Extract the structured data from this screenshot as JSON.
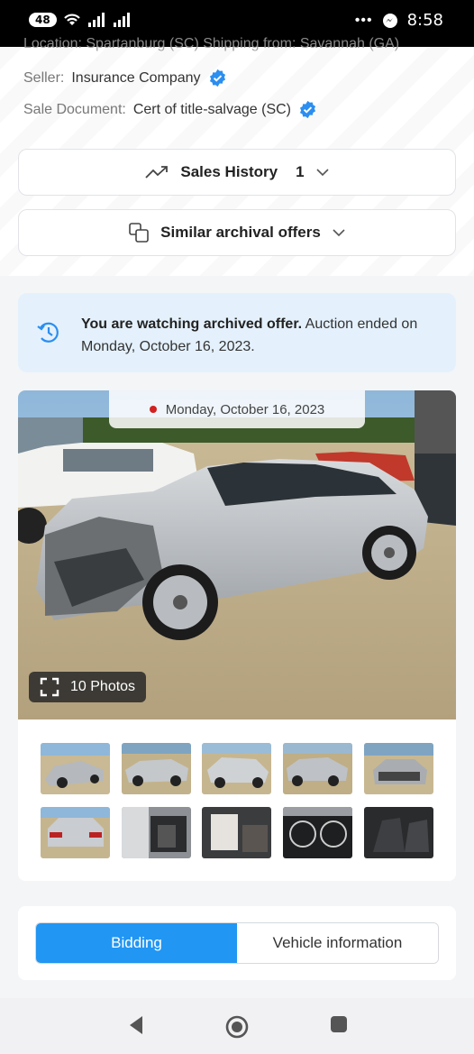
{
  "status_bar": {
    "badge": "48",
    "time": "8:58"
  },
  "details": {
    "cut_line": "Location: Spartanburg (SC)   Shipping from: Savannah (GA)",
    "seller_label": "Seller:",
    "seller_value": "Insurance Company",
    "sale_doc_label": "Sale Document:",
    "sale_doc_value": "Cert of title-salvage (SC)"
  },
  "sales_history": {
    "label": "Sales History",
    "count": "1"
  },
  "similar_offers": {
    "label": "Similar archival offers"
  },
  "banner": {
    "bold": "You are watching archived offer.",
    "text": " Auction ended on Monday, October 16, 2023."
  },
  "gallery": {
    "date": "Monday, October 16, 2023",
    "photos_label": "10 Photos",
    "thumbnail_count": 10
  },
  "tabs": {
    "bidding": "Bidding",
    "vehicle_info": "Vehicle information"
  },
  "colors": {
    "accent": "#2196f3",
    "banner_bg": "#e4f1fc",
    "verified": "#2b8ef0"
  }
}
